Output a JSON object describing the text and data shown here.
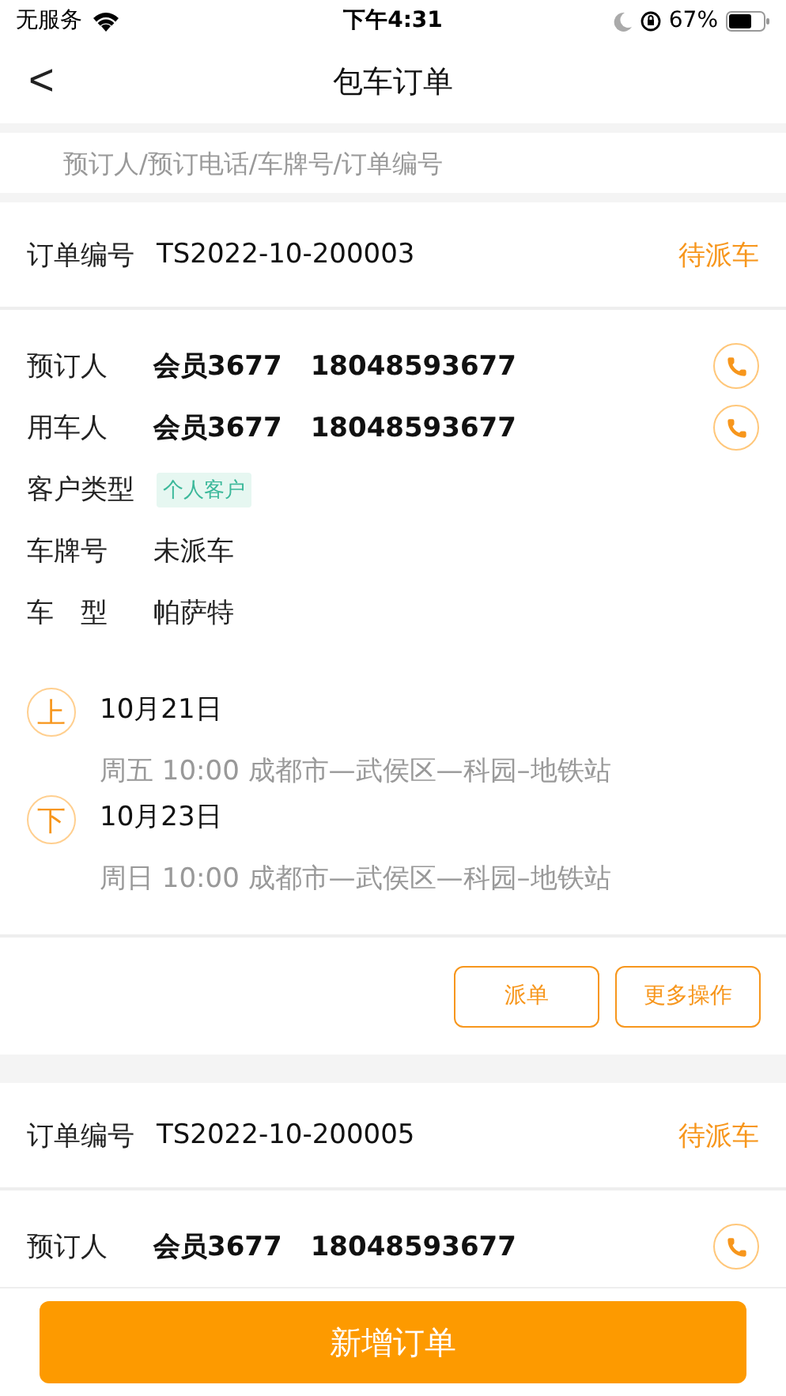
{
  "status_bar": {
    "carrier": "无服务",
    "time": "下午4:31",
    "battery": "67%"
  },
  "nav": {
    "back": "<",
    "title": "包车订单"
  },
  "search": {
    "placeholder": "预订人/预订电话/车牌号/订单编号"
  },
  "orders": [
    {
      "number_label": "订单编号",
      "number": "TS2022-10-200003",
      "status": "待派车",
      "rows": [
        {
          "kind": "contact",
          "label": "预订人",
          "name": "会员3677",
          "phone": "18048593677"
        },
        {
          "kind": "contact",
          "label": "用车人",
          "name": "会员3677",
          "phone": "18048593677"
        },
        {
          "kind": "tag",
          "label": "客户类型",
          "value": "个人客户"
        },
        {
          "kind": "text",
          "label": "车牌号",
          "value": "未派车"
        },
        {
          "kind": "text",
          "label": "车　型",
          "value": "帕萨特"
        }
      ],
      "trips": [
        {
          "marker": "上",
          "date": "10月21日",
          "detail": "周五 10:00 成都市—武侯区—科园–地铁站"
        },
        {
          "marker": "下",
          "date": "10月23日",
          "detail": "周日 10:00 成都市—武侯区—科园–地铁站"
        }
      ],
      "actions": [
        "派单",
        "更多操作"
      ]
    },
    {
      "number_label": "订单编号",
      "number": "TS2022-10-200005",
      "status": "待派车",
      "rows": [
        {
          "kind": "contact",
          "label": "预订人",
          "name": "会员3677",
          "phone": "18048593677"
        }
      ]
    }
  ],
  "bottom_button": "新增订单"
}
